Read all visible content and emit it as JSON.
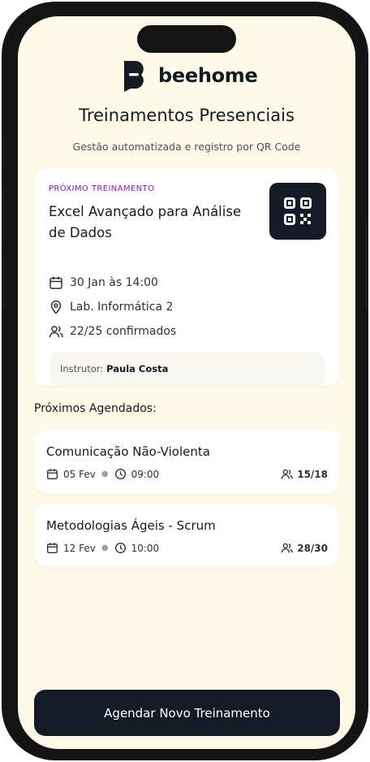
{
  "app": {
    "brand_name": "beehome",
    "logo_icon": "beehome-logo-icon"
  },
  "header": {
    "title": "Treinamentos Presenciais",
    "subtitle": "Gestão automatizada e registro por QR Code"
  },
  "featured": {
    "overline": "PRÓXIMO TREINAMENTO",
    "title": "Excel Avançado para Análise de Dados",
    "qr_icon": "qr-code-icon",
    "date": "30 Jan às 14:00",
    "location": "Lab. Informática 2",
    "attendance": "22/25 confirmados",
    "instructor_label": "Instrutor:",
    "instructor_name": "Paula Costa"
  },
  "upcoming": {
    "section_title": "Próximos Agendados:",
    "items": [
      {
        "title": "Comunicação Não-Violenta",
        "date": "05 Fev",
        "time": "09:00",
        "count": "15/18"
      },
      {
        "title": "Metodologias Ágeis - Scrum",
        "date": "12 Fev",
        "time": "10:00",
        "count": "28/30"
      }
    ]
  },
  "cta": {
    "label": "Agendar Novo Treinamento"
  },
  "colors": {
    "background": "#fdf9e6",
    "accent_purple": "#8a16c8",
    "dark_navy": "#141a26",
    "card": "#ffffff"
  }
}
